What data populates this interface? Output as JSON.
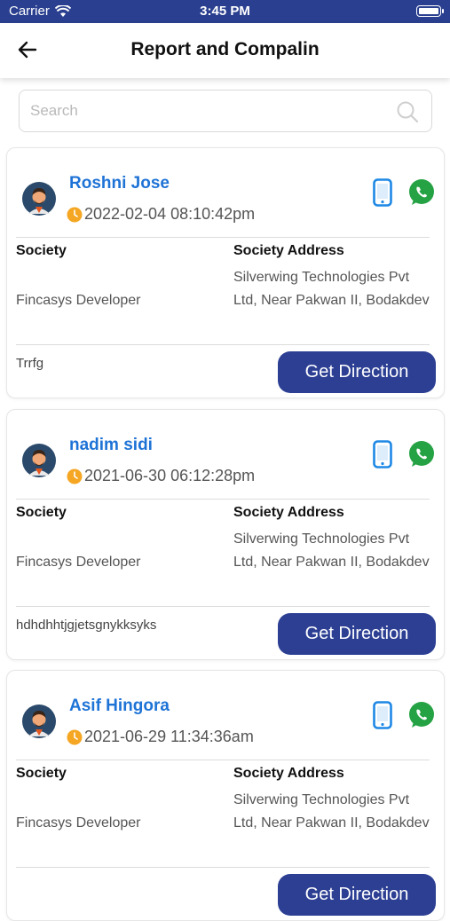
{
  "status_bar": {
    "carrier": "Carrier",
    "time": "3:45 PM"
  },
  "header": {
    "title": "Report and Compalin"
  },
  "search": {
    "placeholder": "Search",
    "value": ""
  },
  "labels": {
    "society": "Society",
    "society_address": "Society Address",
    "get_direction": "Get Direction"
  },
  "colors": {
    "status_bar_bg": "#2a3f8f",
    "name_text": "#1e73d6",
    "button_bg": "#2c3f93",
    "clock_icon": "#f5a623",
    "phone_icon": "#1e88e5",
    "whatsapp_icon": "#25a244"
  },
  "reports": [
    {
      "name": "Roshni Jose",
      "datetime": "2022-02-04 08:10:42pm",
      "society": "Fincasys Developer",
      "address": "Silverwing Technologies Pvt Ltd, Near Pakwan II, Bodakdev",
      "description": "Trrfg"
    },
    {
      "name": "nadim sidi",
      "datetime": "2021-06-30 06:12:28pm",
      "society": "Fincasys Developer",
      "address": "Silverwing Technologies Pvt Ltd, Near Pakwan II, Bodakdev",
      "description": "hdhdhhtjgjetsgnykksyks"
    },
    {
      "name": "Asif Hingora",
      "datetime": "2021-06-29 11:34:36am",
      "society": "Fincasys Developer",
      "address": "Silverwing Technologies Pvt Ltd, Near Pakwan II, Bodakdev",
      "description": ""
    }
  ]
}
